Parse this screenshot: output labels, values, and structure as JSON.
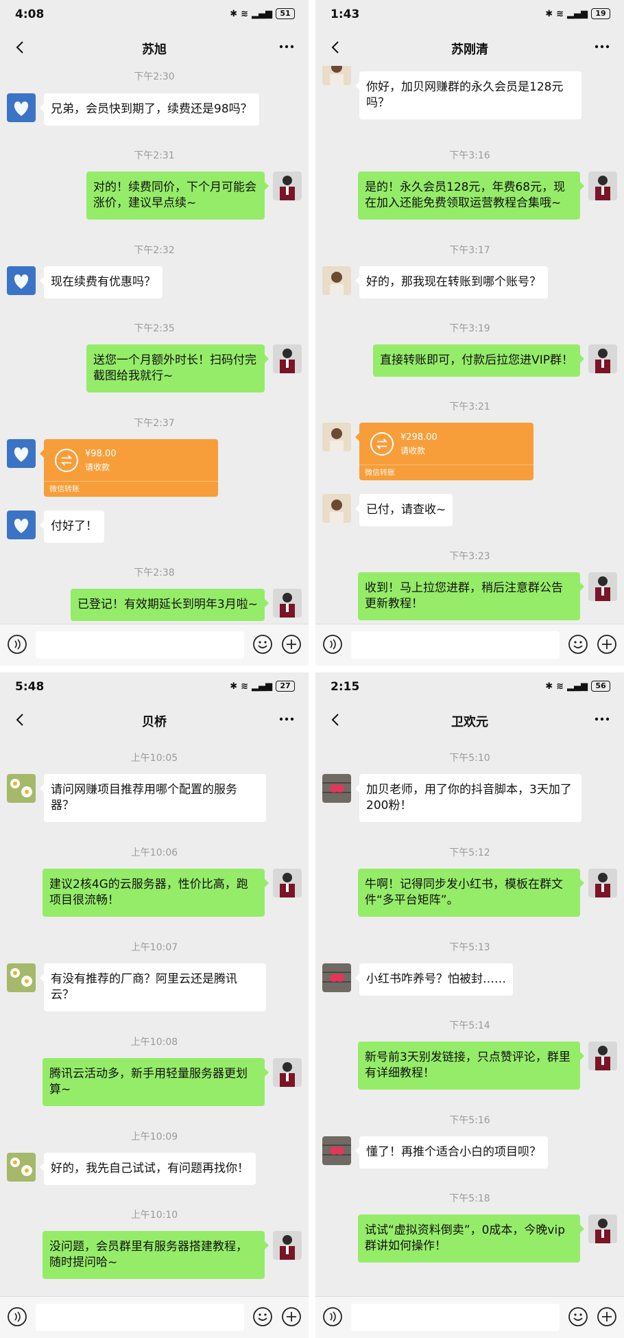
{
  "phones": [
    {
      "status": {
        "time": "4:08",
        "battery": "51"
      },
      "title": "苏旭",
      "messages": [
        {
          "ts": "下午2:30"
        },
        {
          "from": "in",
          "text": "兄弟，会员快到期了，续费还是98吗？"
        },
        {
          "ts": "下午2:31"
        },
        {
          "from": "out",
          "text": "对的！续费同价，下个月可能会涨价，建议早点续~"
        },
        {
          "ts": "下午2:32"
        },
        {
          "from": "in",
          "text": "现在续费有优惠吗？"
        },
        {
          "ts": "下午2:35"
        },
        {
          "from": "out",
          "text": "送您一个月额外时长！扫码付完截图给我就行~"
        },
        {
          "ts": "下午2:37"
        },
        {
          "from": "in",
          "transfer": {
            "amount": "¥98.00",
            "note": "请收款",
            "footer": "微信转账"
          }
        },
        {
          "from": "in",
          "text": "付好了！"
        },
        {
          "ts": "下午2:38"
        },
        {
          "from": "out",
          "text": "已登记！有效期延长到明年3月啦~"
        }
      ]
    },
    {
      "status": {
        "time": "1:43",
        "battery": "19"
      },
      "title": "苏刚清",
      "messages": [
        {
          "from": "in",
          "text": "你好，加贝网赚群的永久会员是128元吗？"
        },
        {
          "ts": "下午3:16"
        },
        {
          "from": "out",
          "text": "是的！永久会员128元，年费68元，现在加入还能免费领取运营教程合集哦~"
        },
        {
          "ts": "下午3:17"
        },
        {
          "from": "in",
          "text": "好的，那我现在转账到哪个账号？"
        },
        {
          "ts": "下午3:19"
        },
        {
          "from": "out",
          "text": "直接转账即可，付款后拉您进VIP群！"
        },
        {
          "ts": "下午3:21"
        },
        {
          "from": "in",
          "transfer": {
            "amount": "¥298.00",
            "note": "请收款",
            "footer": "微信转账"
          }
        },
        {
          "from": "in",
          "text": "已付，请查收~"
        },
        {
          "ts": "下午3:23"
        },
        {
          "from": "out",
          "text": "收到！马上拉您进群，稍后注意群公告更新教程！"
        }
      ]
    },
    {
      "status": {
        "time": "5:48",
        "battery": "27"
      },
      "title": "贝桥",
      "messages": [
        {
          "ts": "上午10:05"
        },
        {
          "from": "in",
          "text": "请问网赚项目推荐用哪个配置的服务器？"
        },
        {
          "ts": "上午10:06"
        },
        {
          "from": "out",
          "text": "建议2核4G的云服务器，性价比高，跑项目很流畅！"
        },
        {
          "ts": "上午10:07"
        },
        {
          "from": "in",
          "text": "有没有推荐的厂商？阿里云还是腾讯云？"
        },
        {
          "ts": "上午10:08"
        },
        {
          "from": "out",
          "text": "腾讯云活动多，新手用轻量服务器更划算~"
        },
        {
          "ts": "上午10:09"
        },
        {
          "from": "in",
          "text": "好的，我先自己试试，有问题再找你！"
        },
        {
          "ts": "上午10:10"
        },
        {
          "from": "out",
          "text": "没问题，会员群里有服务器搭建教程，随时提问哈~"
        }
      ]
    },
    {
      "status": {
        "time": "2:15",
        "battery": "56"
      },
      "title": "卫欢元",
      "messages": [
        {
          "ts": "下午5:10"
        },
        {
          "from": "in",
          "text": "加贝老师，用了你的抖音脚本，3天加了200粉！"
        },
        {
          "ts": "下午5:12"
        },
        {
          "from": "out",
          "text": "牛啊！记得同步发小红书，模板在群文件“多平台矩阵”。"
        },
        {
          "ts": "下午5:13"
        },
        {
          "from": "in",
          "text": "小红书咋养号？怕被封……"
        },
        {
          "ts": "下午5:14"
        },
        {
          "from": "out",
          "text": "新号前3天别发链接，只点赞评论，群里有详细教程！"
        },
        {
          "ts": "下午5:16"
        },
        {
          "from": "in",
          "text": "懂了！再推个适合小白的项目呗？"
        },
        {
          "ts": "下午5:18"
        },
        {
          "from": "out",
          "text": "试试“虚拟资料倒卖”，0成本，今晚vip群讲如何操作！"
        }
      ]
    }
  ]
}
